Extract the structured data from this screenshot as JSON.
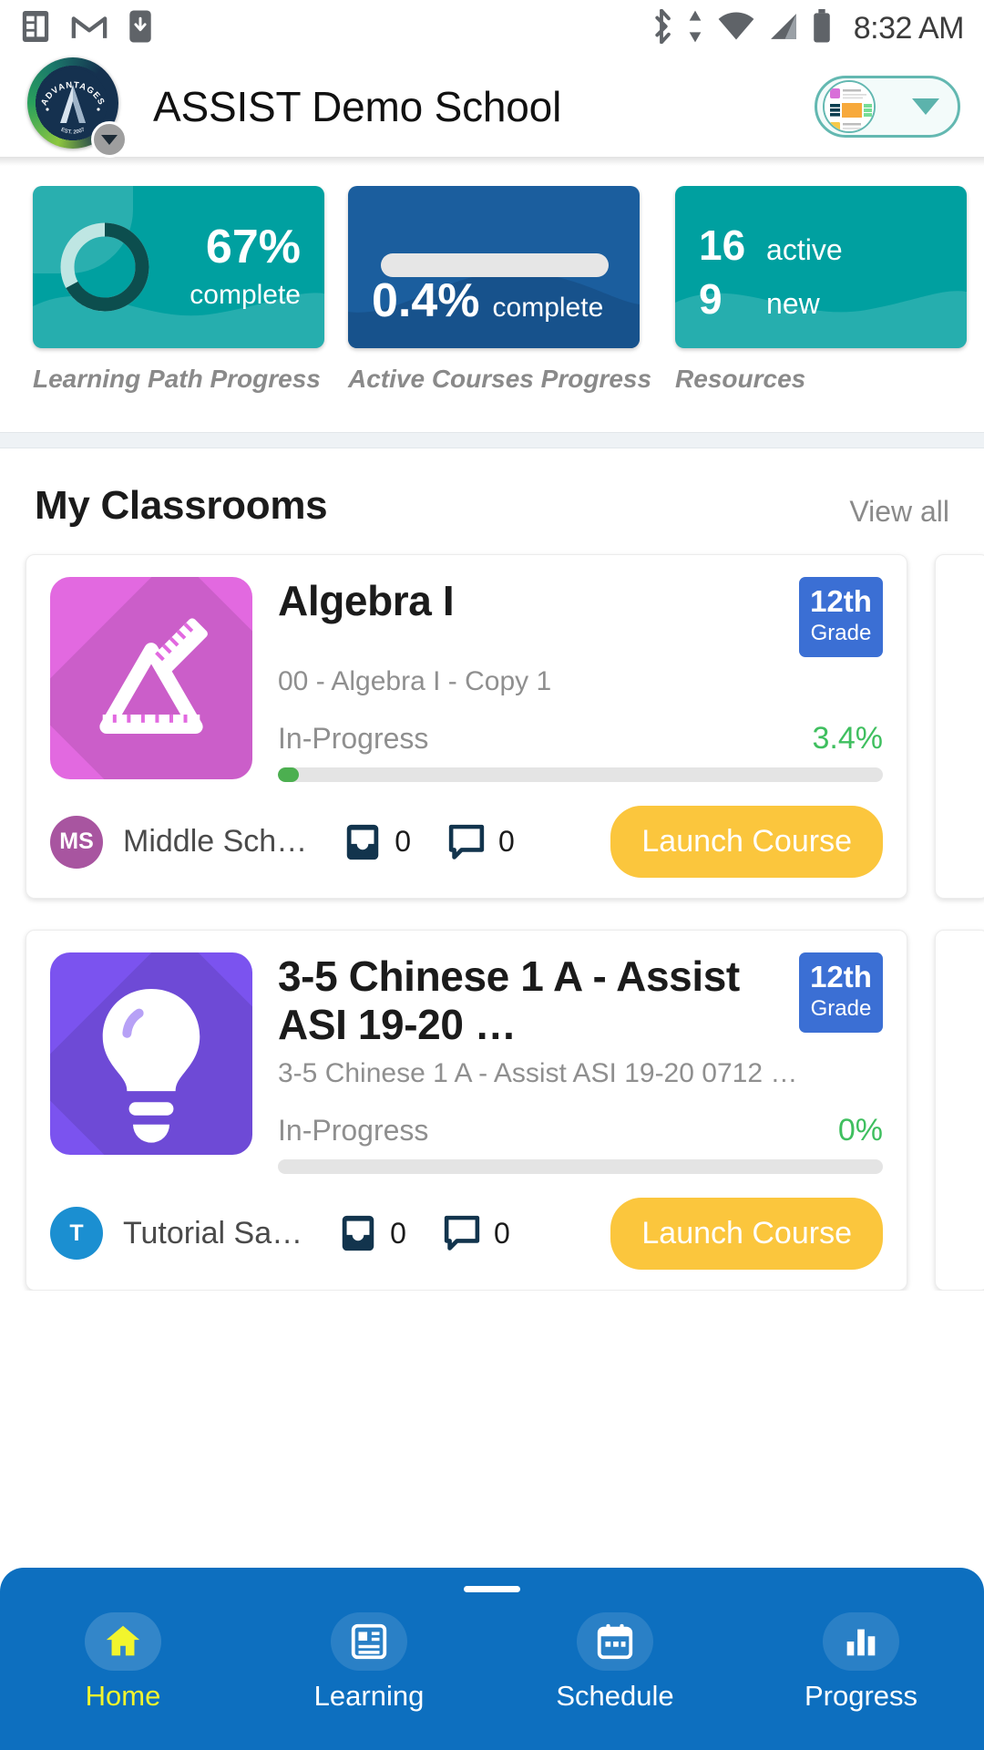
{
  "statusbar": {
    "time": "8:32 AM",
    "left_icons": [
      "notes-icon",
      "gmail-icon",
      "download-to-phone-icon"
    ],
    "right_icons": [
      "bluetooth-icon",
      "sync-arrows-icon",
      "wifi-icon",
      "cellular-signal-icon",
      "battery-icon"
    ]
  },
  "header": {
    "school_name": "ASSIST Demo School",
    "logo": {
      "top_text": "ADVANTAGES",
      "letter": "A",
      "bottom_text": "EST. 2007"
    },
    "profile_selector": {
      "caret": "chevron-down-icon"
    }
  },
  "stats": [
    {
      "id": "learning-path-progress",
      "kind": "donut",
      "value": "67%",
      "unit": "complete",
      "caption": "Learning Path Progress",
      "percent": 67,
      "bg": "#00a0a0",
      "arc_color": "#0c4e4e",
      "track_color": "#bfe6e3"
    },
    {
      "id": "active-courses-progress",
      "kind": "bar",
      "value": "0.4%",
      "unit": "complete",
      "caption": "Active Courses Progress",
      "percent": 0.4,
      "bg": "#1b5e9e",
      "bar_track": "#e6e6e6"
    },
    {
      "id": "resources",
      "kind": "counts",
      "caption": "Resources",
      "rows": [
        {
          "number": "16",
          "text": "active"
        },
        {
          "number": "9",
          "text": "new"
        }
      ],
      "bg": "#00a0a0"
    }
  ],
  "classrooms_section": {
    "title": "My Classrooms",
    "view_all": "View all"
  },
  "classrooms": [
    {
      "name": "Algebra I",
      "subtitle": "00 - Algebra I - Copy 1",
      "grade_number": "12th",
      "grade_word": "Grade",
      "status": "In-Progress",
      "percent_label": "3.4%",
      "percent": 3.4,
      "tile_icon": "ruler-triangle-icon",
      "tile_color": "#e269e0",
      "avatar_initials": "MS",
      "avatar_color": "#a855a0",
      "school": "Middle Sch…",
      "inbox_count": "0",
      "comment_count": "0",
      "launch_label": "Launch Course"
    },
    {
      "name": "3-5 Chinese 1 A - Assist ASI 19-20 …",
      "subtitle": "3-5 Chinese 1 A - Assist ASI 19-20 0712 …",
      "grade_number": "12th",
      "grade_word": "Grade",
      "status": "In-Progress",
      "percent_label": "0%",
      "percent": 0,
      "tile_icon": "lightbulb-icon",
      "tile_color": "#7b53ef",
      "avatar_initials": "T",
      "avatar_color": "#1b8fd1",
      "school": "Tutorial Sa…",
      "inbox_count": "0",
      "comment_count": "0",
      "launch_label": "Launch Course"
    }
  ],
  "bottom_nav": {
    "items": [
      {
        "label": "Home",
        "icon": "home-icon",
        "active": true
      },
      {
        "label": "Learning",
        "icon": "book-grid-icon",
        "active": false
      },
      {
        "label": "Schedule",
        "icon": "calendar-icon",
        "active": false
      },
      {
        "label": "Progress",
        "icon": "bar-chart-icon",
        "active": false
      }
    ],
    "active_color": "#f2f52d",
    "bg": "#0d6fbf"
  }
}
